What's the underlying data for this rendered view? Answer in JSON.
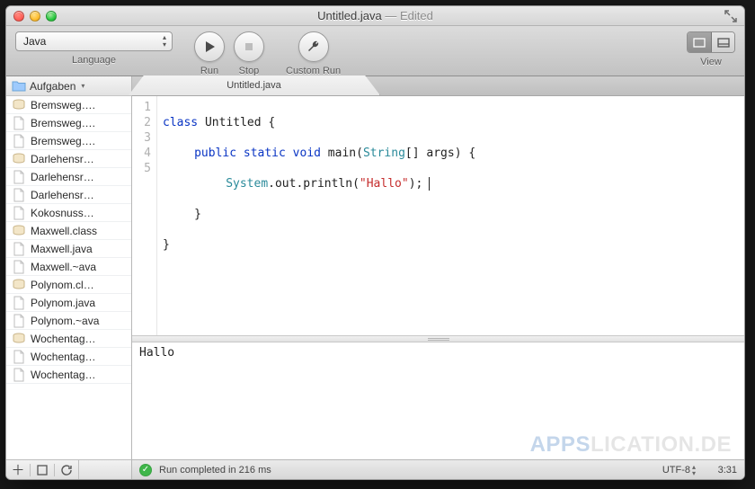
{
  "window": {
    "title": "Untitled.java",
    "edited_suffix": " — Edited"
  },
  "toolbar": {
    "language_label": "Language",
    "language_value": "Java",
    "run_label": "Run",
    "stop_label": "Stop",
    "custom_run_label": "Custom Run",
    "view_label": "View"
  },
  "sidebar": {
    "breadcrumb": "Aufgaben",
    "items": [
      {
        "name": "Bremsweg….",
        "type": "class"
      },
      {
        "name": "Bremsweg….",
        "type": "java"
      },
      {
        "name": "Bremsweg….",
        "type": "java"
      },
      {
        "name": "Darlehensr…",
        "type": "class"
      },
      {
        "name": "Darlehensr…",
        "type": "java"
      },
      {
        "name": "Darlehensr…",
        "type": "java"
      },
      {
        "name": "Kokosnuss…",
        "type": "java"
      },
      {
        "name": "Maxwell.class",
        "type": "class"
      },
      {
        "name": "Maxwell.java",
        "type": "java"
      },
      {
        "name": "Maxwell.~ava",
        "type": "java"
      },
      {
        "name": "Polynom.cl…",
        "type": "class"
      },
      {
        "name": "Polynom.java",
        "type": "java"
      },
      {
        "name": "Polynom.~ava",
        "type": "java"
      },
      {
        "name": "Wochentag…",
        "type": "class"
      },
      {
        "name": "Wochentag…",
        "type": "java"
      },
      {
        "name": "Wochentag…",
        "type": "java"
      }
    ]
  },
  "tabs": [
    {
      "label": "Untitled.java"
    }
  ],
  "code": {
    "line_numbers": [
      "1",
      "2",
      "3",
      "4",
      "5"
    ],
    "l1_kw1": "class",
    "l1_rest": " Untitled {",
    "l2_kw": "public static void",
    "l2_mid": " main(",
    "l2_type": "String",
    "l2_after": "[] args) {",
    "l3_obj": "System",
    "l3_mid": ".out.println(",
    "l3_str": "\"Hallo\"",
    "l3_end": ");",
    "l4": "}",
    "l5": "}"
  },
  "console": {
    "output": "Hallo"
  },
  "status": {
    "message": "Run completed in 216 ms",
    "encoding": "UTF-8",
    "caret": "3:31"
  },
  "watermark": {
    "a": "APPS",
    "b": "LICATION.DE"
  }
}
